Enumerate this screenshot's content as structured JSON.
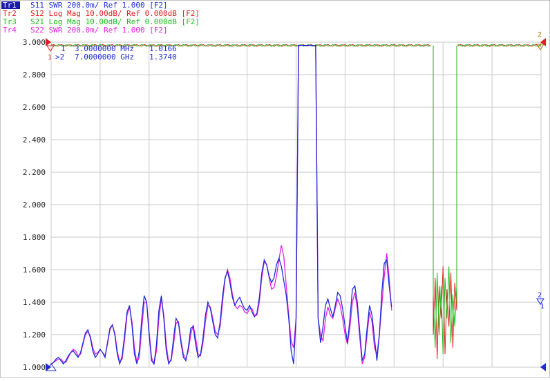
{
  "traces": [
    {
      "tag": "Tr1",
      "text": "S11 SWR 200.0m/ Ref 1.000 [F2]",
      "color": "#1f2bd6"
    },
    {
      "tag": "Tr2",
      "text": "S12 Log Mag 10.00dB/ Ref 0.000dB [F2]",
      "color": "#e02020"
    },
    {
      "tag": "Tr3",
      "text": "S21 Log Mag 10.00dB/ Ref 0.000dB [F2]",
      "color": "#17c017"
    },
    {
      "tag": "Tr4",
      "text": "S22 SWR 200.0m/ Ref 1.000 [F2]",
      "color": "#e020e0"
    }
  ],
  "markers": [
    {
      "label": "1",
      "freq": "3.0000000 MHz",
      "value": "1.0166"
    },
    {
      "label": ">2",
      "freq": "7.0000000 GHz",
      "value": "1.3740"
    }
  ],
  "chart_data": {
    "type": "line",
    "ylim": [
      1.0,
      3.0
    ],
    "yticks": [
      "3.000",
      "2.800",
      "2.600",
      "2.400",
      "2.200",
      "2.000",
      "1.800",
      "1.600",
      "1.400",
      "1.200",
      "1.000"
    ],
    "x_divisions": 10,
    "grid": true,
    "x": [
      0,
      0.5,
      1,
      1.5,
      2,
      2.5,
      3,
      3.5,
      4,
      4.5,
      5,
      5.5,
      6,
      6.5,
      7,
      7.5,
      8,
      8.5,
      9,
      9.5,
      10,
      10.5,
      11,
      11.5,
      12,
      12.5,
      13,
      13.5,
      14,
      14.5,
      15,
      15.5,
      16,
      16.5,
      17,
      17.5,
      18,
      18.5,
      19,
      19.5,
      20,
      20.5,
      21,
      21.5,
      22,
      22.5,
      23,
      23.5,
      24,
      24.5,
      25,
      25.5,
      26,
      26.5,
      27,
      27.5,
      28,
      28.5,
      29,
      29.5,
      30,
      30.5,
      31,
      31.5,
      32,
      32.5,
      33,
      33.5,
      34,
      34.5,
      35,
      35.5,
      36,
      36.5,
      37,
      37.5,
      38,
      38.5,
      39,
      39.5,
      40,
      40.5,
      41,
      41.5,
      42,
      42.5,
      43,
      43.5,
      44,
      44.5,
      45,
      45.5,
      46,
      46.5,
      47,
      47.5,
      48,
      48.5,
      49,
      49.5,
      50,
      50.5,
      51,
      51.5,
      52,
      52.5,
      53,
      53.5,
      54,
      54.5,
      55,
      55.5,
      56,
      56.5,
      57,
      57.5,
      58,
      58.5,
      59,
      59.5,
      60,
      60.5,
      61,
      61.5,
      62,
      62.5,
      63,
      63.5,
      64,
      64.5,
      65,
      65.5,
      66,
      66.5,
      67,
      67.5,
      68,
      68.5,
      69,
      69.5,
      70,
      70.5,
      71,
      71.5,
      72,
      72.5,
      73,
      73.5,
      74,
      74.5,
      75,
      75.5,
      76,
      76.5,
      77,
      77.5,
      78,
      78.5,
      79,
      79.5,
      80,
      80.5,
      81,
      81.5,
      82,
      82.5,
      83,
      83.5,
      84,
      84.5,
      85,
      85.5,
      86,
      86.5,
      87,
      87.5,
      88,
      88.5,
      89,
      89.5,
      90,
      90.5,
      91,
      91.5,
      92,
      92.5,
      93,
      93.5,
      94,
      94.5,
      95,
      95.5,
      96,
      96.5,
      97,
      97.5,
      98,
      98.5,
      99,
      99.5,
      100
    ],
    "series": [
      {
        "name": "Tr1 S11",
        "color": "#1f2bd6",
        "values": [
          1.017,
          1.03,
          1.05,
          1.06,
          1.04,
          1.02,
          1.04,
          1.07,
          1.09,
          1.1,
          1.08,
          1.06,
          1.09,
          1.15,
          1.21,
          1.23,
          1.18,
          1.1,
          1.06,
          1.08,
          1.11,
          1.09,
          1.06,
          1.15,
          1.24,
          1.26,
          1.2,
          1.08,
          1.02,
          1.07,
          1.2,
          1.34,
          1.38,
          1.26,
          1.08,
          1.02,
          1.1,
          1.3,
          1.44,
          1.4,
          1.2,
          1.04,
          1.02,
          1.14,
          1.35,
          1.44,
          1.3,
          1.1,
          1.02,
          1.05,
          1.18,
          1.3,
          1.27,
          1.15,
          1.06,
          1.04,
          1.12,
          1.24,
          1.25,
          1.14,
          1.06,
          1.08,
          1.18,
          1.32,
          1.4,
          1.36,
          1.28,
          1.2,
          1.18,
          1.28,
          1.44,
          1.55,
          1.59,
          1.52,
          1.43,
          1.38,
          1.41,
          1.43,
          1.39,
          1.36,
          1.35,
          1.38,
          1.34,
          1.31,
          1.33,
          1.43,
          1.58,
          1.66,
          1.63,
          1.56,
          1.52,
          1.55,
          1.63,
          1.67,
          1.62,
          1.53,
          1.44,
          1.3,
          1.1,
          1.02,
          1.3,
          2.98,
          2.98,
          2.98,
          2.98,
          2.98,
          2.98,
          2.98,
          2.98,
          1.3,
          1.15,
          1.25,
          1.38,
          1.42,
          1.36,
          1.31,
          1.38,
          1.46,
          1.44,
          1.36,
          1.25,
          1.15,
          1.3,
          1.48,
          1.5,
          1.4,
          1.22,
          1.04,
          1.08,
          1.24,
          1.38,
          1.32,
          1.18,
          1.04,
          1.2,
          1.46,
          1.64,
          1.66,
          1.5,
          1.37
        ]
      },
      {
        "name": "Tr4 S22",
        "color": "#e020e0",
        "values": [
          1.02,
          1.03,
          1.04,
          1.05,
          1.05,
          1.03,
          1.03,
          1.06,
          1.09,
          1.11,
          1.1,
          1.07,
          1.08,
          1.14,
          1.2,
          1.22,
          1.19,
          1.12,
          1.08,
          1.09,
          1.11,
          1.09,
          1.07,
          1.14,
          1.23,
          1.26,
          1.21,
          1.1,
          1.03,
          1.05,
          1.17,
          1.32,
          1.37,
          1.28,
          1.12,
          1.03,
          1.06,
          1.24,
          1.4,
          1.4,
          1.22,
          1.06,
          1.02,
          1.1,
          1.3,
          1.42,
          1.32,
          1.14,
          1.03,
          1.04,
          1.14,
          1.27,
          1.28,
          1.17,
          1.08,
          1.05,
          1.1,
          1.2,
          1.26,
          1.18,
          1.08,
          1.07,
          1.15,
          1.28,
          1.38,
          1.37,
          1.3,
          1.22,
          1.2,
          1.25,
          1.4,
          1.54,
          1.6,
          1.55,
          1.45,
          1.38,
          1.36,
          1.38,
          1.37,
          1.34,
          1.33,
          1.36,
          1.36,
          1.32,
          1.32,
          1.4,
          1.55,
          1.65,
          1.63,
          1.55,
          1.48,
          1.49,
          1.56,
          1.66,
          1.75,
          1.68,
          1.5,
          1.32,
          1.16,
          1.12,
          1.3,
          2.98,
          2.98,
          2.98,
          2.98,
          2.98,
          2.98,
          2.98,
          2.98,
          1.3,
          1.2,
          1.16,
          1.3,
          1.37,
          1.32,
          1.3,
          1.36,
          1.42,
          1.38,
          1.3,
          1.2,
          1.14,
          1.25,
          1.4,
          1.46,
          1.36,
          1.18,
          1.02,
          1.06,
          1.2,
          1.34,
          1.28,
          1.12,
          1.08,
          1.2,
          1.38,
          1.56,
          1.7,
          1.55,
          1.35
        ]
      }
    ],
    "band_series": [
      {
        "name": "Tr2 S12",
        "color": "#e02020",
        "ref_value": 2.98,
        "values": [
          1.2,
          1.55,
          1.05,
          1.5,
          1.3,
          1.62,
          1.08,
          1.48,
          1.25,
          1.58,
          1.12,
          1.52,
          1.35
        ]
      },
      {
        "name": "Tr3 S21",
        "color": "#17c017",
        "ref_value": 2.98,
        "values": [
          1.45,
          1.12,
          1.58,
          1.2,
          1.5,
          1.08,
          1.55,
          1.3,
          1.62,
          1.15,
          1.45,
          1.25,
          1.5
        ]
      }
    ],
    "band_x": [
      78,
      78.4,
      78.8,
      79.2,
      79.6,
      80,
      80.4,
      80.8,
      81.2,
      81.6,
      82,
      82.4,
      82.8
    ]
  }
}
